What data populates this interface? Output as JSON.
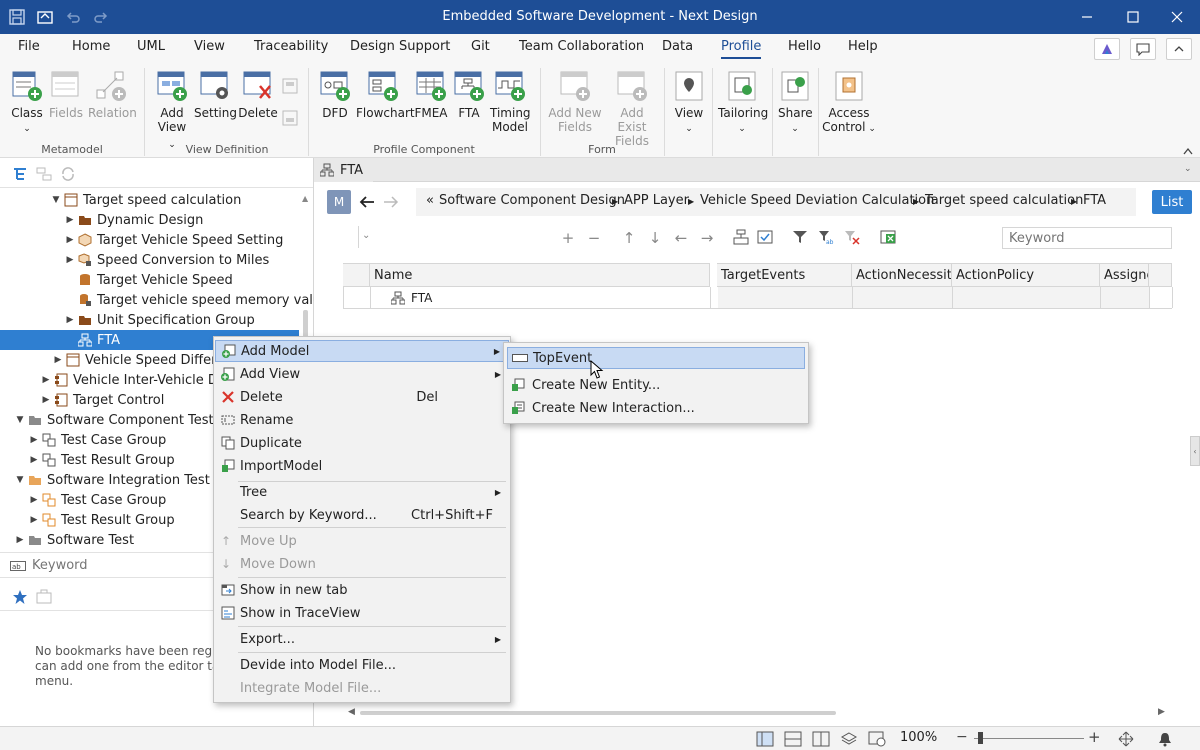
{
  "window": {
    "title": "Embedded Software Development - Next Design"
  },
  "menu": {
    "items": [
      "File",
      "Home",
      "UML",
      "View",
      "Traceability",
      "Design Support",
      "Git",
      "Team Collaboration",
      "Data",
      "Profile",
      "Hello",
      "Help"
    ],
    "active": "Profile"
  },
  "ribbon": {
    "metamodel": {
      "class": "Class",
      "fields": "Fields",
      "relation": "Relation",
      "group": "Metamodel"
    },
    "view_definition": {
      "add_view_1": "Add",
      "add_view_2": "View",
      "setting": "Setting",
      "delete": "Delete",
      "group": "View Definition"
    },
    "profile_component": {
      "dfd": "DFD",
      "flowchart": "Flowchart",
      "fmea": "FMEA",
      "fta": "FTA",
      "timing_1": "Timing",
      "timing_2": "Model",
      "group": "Profile Component"
    },
    "form": {
      "add_new_1": "Add New",
      "add_new_2": "Fields",
      "add_exist_1": "Add Exist",
      "add_exist_2": "Fields",
      "group": "Form"
    },
    "view": "View",
    "tailoring": "Tailoring",
    "share": "Share",
    "access_1": "Access",
    "access_2": "Control"
  },
  "tree": {
    "items": [
      {
        "label": "Target speed calculation"
      },
      {
        "label": "Dynamic Design"
      },
      {
        "label": "Target Vehicle Speed Setting"
      },
      {
        "label": "Speed Conversion to Miles"
      },
      {
        "label": "Target Vehicle Speed"
      },
      {
        "label": "Target vehicle speed memory valu"
      },
      {
        "label": "Unit Specification Group"
      },
      {
        "label": "FTA"
      },
      {
        "label": "Vehicle Speed Differe"
      },
      {
        "label": "Vehicle Inter-Vehicle Di"
      },
      {
        "label": "Target Control"
      },
      {
        "label": "Software Component Test"
      },
      {
        "label": "Test Case Group"
      },
      {
        "label": "Test Result Group"
      },
      {
        "label": "Software Integration Test"
      },
      {
        "label": "Test Case Group"
      },
      {
        "label": "Test Result Group"
      },
      {
        "label": "Software Test"
      }
    ],
    "keyword_placeholder": "Keyword"
  },
  "bookmarks": {
    "empty_line1": "No bookmarks have been regis",
    "empty_line2": "can add one from the editor ta",
    "empty_line3": "menu."
  },
  "editor": {
    "tab": "FTA",
    "mode_badge": "M",
    "breadcrumb": [
      "«",
      "Software Component Design",
      "APP Layer",
      "Vehicle Speed Deviation Calculation",
      "Target speed calculation",
      "FTA"
    ],
    "list_button": "List",
    "keyword_placeholder": "Keyword",
    "columns": [
      "Name",
      "TargetEvents",
      "ActionNecessity",
      "ActionPolicy",
      "Assigne"
    ],
    "rows": [
      {
        "name": "FTA"
      }
    ]
  },
  "context_menu": {
    "items": [
      {
        "label": "Add Model"
      },
      {
        "label": "Add View"
      },
      {
        "label": "Delete",
        "shortcut": "Del"
      },
      {
        "label": "Rename"
      },
      {
        "label": "Duplicate"
      },
      {
        "label": "ImportModel"
      },
      {
        "label": "Tree"
      },
      {
        "label": "Search by Keyword...",
        "shortcut": "Ctrl+Shift+F"
      },
      {
        "label": "Move Up"
      },
      {
        "label": "Move Down"
      },
      {
        "label": "Show in new tab"
      },
      {
        "label": "Show in TraceView"
      },
      {
        "label": "Export..."
      },
      {
        "label": "Devide into Model File..."
      },
      {
        "label": "Integrate Model File..."
      }
    ]
  },
  "submenu": {
    "items": [
      {
        "label": "TopEvent"
      },
      {
        "label": "Create New Entity..."
      },
      {
        "label": "Create New Interaction..."
      }
    ]
  },
  "status": {
    "zoom": "100%"
  },
  "colors": {
    "titlebar": "#1e4e96",
    "accent": "#2f7fd1",
    "icon_green": "#3aa04a",
    "icon_red": "#d9342b",
    "folder_brown": "#8a4a1a"
  }
}
